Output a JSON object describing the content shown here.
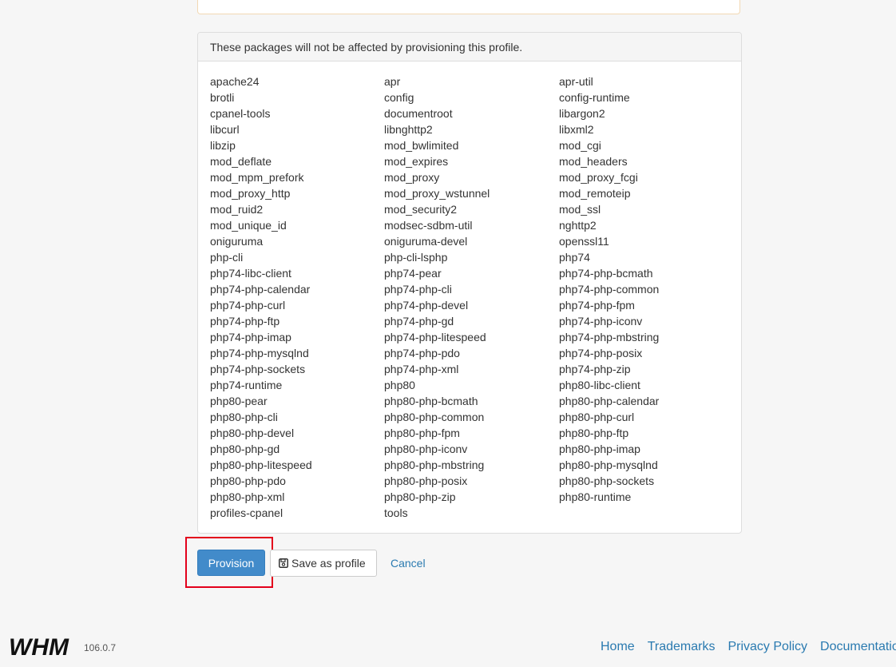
{
  "panel": {
    "heading": "These packages will not be affected by provisioning this profile.",
    "packages": [
      "apache24",
      "apr",
      "apr-util",
      "brotli",
      "config",
      "config-runtime",
      "cpanel-tools",
      "documentroot",
      "libargon2",
      "libcurl",
      "libnghttp2",
      "libxml2",
      "libzip",
      "mod_bwlimited",
      "mod_cgi",
      "mod_deflate",
      "mod_expires",
      "mod_headers",
      "mod_mpm_prefork",
      "mod_proxy",
      "mod_proxy_fcgi",
      "mod_proxy_http",
      "mod_proxy_wstunnel",
      "mod_remoteip",
      "mod_ruid2",
      "mod_security2",
      "mod_ssl",
      "mod_unique_id",
      "modsec-sdbm-util",
      "nghttp2",
      "oniguruma",
      "oniguruma-devel",
      "openssl11",
      "php-cli",
      "php-cli-lsphp",
      "php74",
      "php74-libc-client",
      "php74-pear",
      "php74-php-bcmath",
      "php74-php-calendar",
      "php74-php-cli",
      "php74-php-common",
      "php74-php-curl",
      "php74-php-devel",
      "php74-php-fpm",
      "php74-php-ftp",
      "php74-php-gd",
      "php74-php-iconv",
      "php74-php-imap",
      "php74-php-litespeed",
      "php74-php-mbstring",
      "php74-php-mysqlnd",
      "php74-php-pdo",
      "php74-php-posix",
      "php74-php-sockets",
      "php74-php-xml",
      "php74-php-zip",
      "php74-runtime",
      "php80",
      "php80-libc-client",
      "php80-pear",
      "php80-php-bcmath",
      "php80-php-calendar",
      "php80-php-cli",
      "php80-php-common",
      "php80-php-curl",
      "php80-php-devel",
      "php80-php-fpm",
      "php80-php-ftp",
      "php80-php-gd",
      "php80-php-iconv",
      "php80-php-imap",
      "php80-php-litespeed",
      "php80-php-mbstring",
      "php80-php-mysqlnd",
      "php80-php-pdo",
      "php80-php-posix",
      "php80-php-sockets",
      "php80-php-xml",
      "php80-php-zip",
      "php80-runtime",
      "profiles-cpanel",
      "tools"
    ]
  },
  "actions": {
    "provision_label": "Provision",
    "save_label": "Save as profile",
    "save_icon": "save-icon",
    "cancel_label": "Cancel",
    "primary_color": "#428bca",
    "highlight_color": "#e3001b"
  },
  "footer": {
    "logo_text": "WHM",
    "version": "106.0.7",
    "links": [
      "Home",
      "Trademarks",
      "Privacy Policy",
      "Documentation"
    ],
    "link_color": "#2a7ab0"
  }
}
